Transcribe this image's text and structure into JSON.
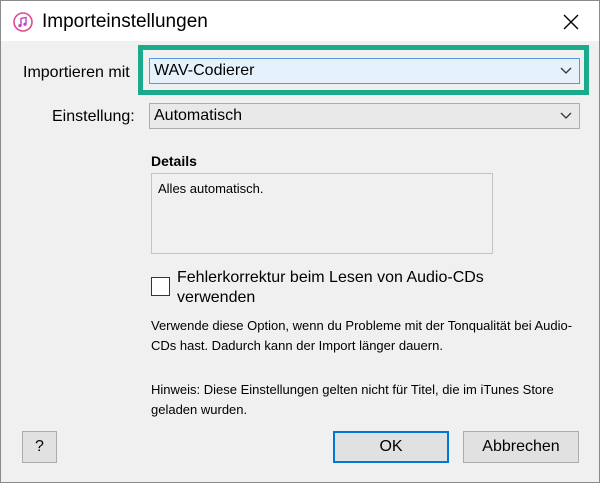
{
  "window": {
    "title": "Importeinstellungen"
  },
  "import_with": {
    "label": "Importieren mit",
    "value": "WAV-Codierer"
  },
  "setting": {
    "label": "Einstellung:",
    "value": "Automatisch"
  },
  "details": {
    "title": "Details",
    "text": "Alles automatisch."
  },
  "error_correction": {
    "label": "Fehlerkorrektur beim Lesen von Audio-CDs verwenden",
    "checked": false,
    "description": "Verwende diese Option, wenn du Probleme mit der Tonqualität bei Audio-CDs hast. Dadurch kann der Import länger dauern."
  },
  "hint": "Hinweis: Diese Einstellungen gelten nicht für Titel, die im iTunes Store geladen wurden.",
  "buttons": {
    "help": "?",
    "ok": "OK",
    "cancel": "Abbrechen"
  },
  "colors": {
    "highlight": "#1aaa8c",
    "active_combo": "#e5f1fb",
    "ok_border": "#0078d7"
  },
  "icons": {
    "app": "itunes-music-note-icon",
    "close": "close-icon",
    "dropdown": "chevron-down-icon"
  }
}
